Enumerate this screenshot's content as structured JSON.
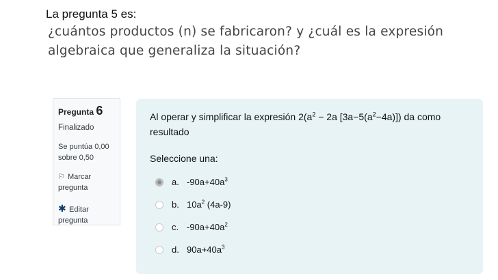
{
  "previous": {
    "heading": "La pregunta 5 es:",
    "text": "¿cuántos productos (n) se fabricaron? y ¿cuál es la expresión algebraica que generaliza la situación?"
  },
  "info": {
    "label": "Pregunta",
    "number": "6",
    "state": "Finalizado",
    "grade": "Se puntúa 0,00 sobre 0,50",
    "flag_label": "Marcar pregunta",
    "edit_label": "Editar pregunta",
    "icons": {
      "flag": "flag-icon",
      "edit": "gear-icon"
    }
  },
  "question": {
    "text_prefix": "Al operar y simplificar la expresión 2(a",
    "text_suffix": "resultado",
    "prompt": "Seleccione una:",
    "options": [
      {
        "letter": "a.",
        "selected": true
      },
      {
        "letter": "b.",
        "selected": false
      },
      {
        "letter": "c.",
        "selected": false
      },
      {
        "letter": "d.",
        "selected": false
      }
    ]
  },
  "colors": {
    "formulation_bg": "#e7f3f5",
    "info_bg": "#f8f9fa",
    "gear": "#0f3b6e"
  }
}
